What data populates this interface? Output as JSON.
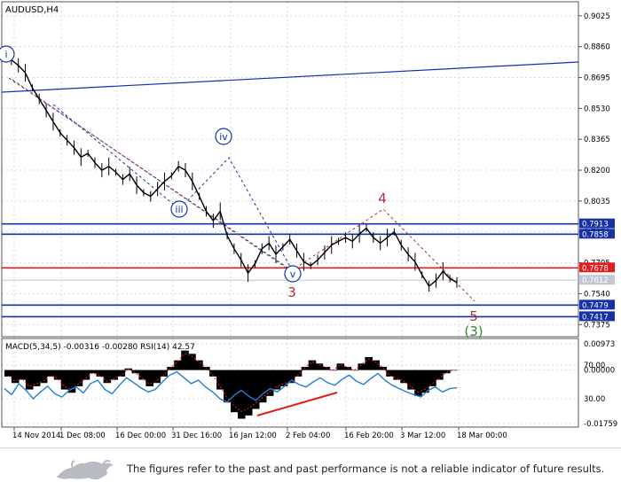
{
  "chart_data": [
    {
      "type": "line",
      "title": "AUDUSD,H4",
      "y_ticks": [
        "0.9025",
        "0.8860",
        "0.8695",
        "0.8530",
        "0.8365",
        "0.8200",
        "0.8035",
        "0.7870",
        "0.7705",
        "0.7540",
        "0.7375"
      ],
      "ylim": [
        0.731,
        0.91
      ],
      "x_ticks": [
        "14 Nov 2014",
        "1 Dec 08:00",
        "16 Dec 00:00",
        "31 Dec 16:00",
        "16 Jan 12:00",
        "2 Feb 04:00",
        "16 Feb 20:00",
        "3 Mar 12:00",
        "18 Mar 00:00"
      ],
      "grid": true,
      "price_series": [
        0.885,
        0.879,
        0.876,
        0.872,
        0.864,
        0.858,
        0.852,
        0.846,
        0.84,
        0.836,
        0.832,
        0.827,
        0.829,
        0.824,
        0.82,
        0.822,
        0.819,
        0.815,
        0.818,
        0.812,
        0.808,
        0.806,
        0.81,
        0.814,
        0.817,
        0.822,
        0.82,
        0.814,
        0.806,
        0.798,
        0.793,
        0.798,
        0.785,
        0.778,
        0.772,
        0.765,
        0.77,
        0.778,
        0.781,
        0.775,
        0.779,
        0.783,
        0.777,
        0.771,
        0.769,
        0.772,
        0.776,
        0.78,
        0.782,
        0.784,
        0.782,
        0.786,
        0.789,
        0.784,
        0.781,
        0.784,
        0.787,
        0.78,
        0.775,
        0.771,
        0.764,
        0.758,
        0.761,
        0.766,
        0.762,
        0.76
      ],
      "horizontal_levels": [
        {
          "value": 0.7913,
          "label": "0.7913",
          "color": "#1630a8"
        },
        {
          "value": 0.7858,
          "label": "0.7858",
          "color": "#1630a8"
        },
        {
          "value": 0.7678,
          "label": "0.7678",
          "color": "#e31d1d"
        },
        {
          "value": 0.7612,
          "label": "0.7612",
          "color": "#c2c8cf"
        },
        {
          "value": 0.7479,
          "label": "0.7479",
          "color": "#1630a8"
        },
        {
          "value": 0.7417,
          "label": "0.7417",
          "color": "#1630a8"
        }
      ],
      "wave_labels": [
        {
          "text": "i",
          "circled": true,
          "color": "#1630a8"
        },
        {
          "text": "iii",
          "circled": true,
          "color": "#1630a8"
        },
        {
          "text": "iv",
          "circled": true,
          "color": "#1630a8"
        },
        {
          "text": "v",
          "circled": true,
          "color": "#1630a8"
        },
        {
          "text": "3",
          "circled": false,
          "color": "#b2322d"
        },
        {
          "text": "4",
          "circled": false,
          "color": "#b2322d"
        },
        {
          "text": "5",
          "circled": false,
          "color": "#b2322d"
        },
        {
          "text": "(3)",
          "circled": false,
          "color": "#2e8b2e"
        }
      ]
    },
    {
      "type": "bar",
      "title": "MACD(5,34,5) -0.00316 -0.00280 RSI(14) 42.57",
      "y_ticks": [
        "0.00973",
        "70.00",
        "0.00000",
        "30.00",
        "-0.01759"
      ],
      "grid": true,
      "macd_values": [
        -0.002,
        -0.004,
        -0.003,
        -0.006,
        -0.005,
        -0.004,
        -0.002,
        -0.003,
        -0.006,
        -0.007,
        -0.005,
        -0.003,
        -0.001,
        -0.002,
        -0.004,
        -0.003,
        -0.002,
        0.0005,
        -0.001,
        -0.003,
        -0.005,
        -0.004,
        -0.002,
        0.001,
        0.003,
        0.006,
        0.005,
        0.003,
        0.001,
        -0.002,
        -0.006,
        -0.01,
        -0.013,
        -0.015,
        -0.014,
        -0.012,
        -0.01,
        -0.008,
        -0.006,
        -0.005,
        -0.004,
        -0.002,
        0.001,
        0.003,
        0.002,
        0.001,
        0.0,
        0.002,
        0.001,
        0.0,
        0.002,
        0.004,
        0.003,
        0.001,
        -0.002,
        -0.003,
        -0.004,
        -0.006,
        -0.008,
        -0.007,
        -0.005,
        -0.003,
        -0.001,
        0.0
      ],
      "rsi_values": [
        42,
        35,
        48,
        40,
        30,
        38,
        45,
        36,
        32,
        40,
        44,
        37,
        48,
        52,
        41,
        36,
        46,
        55,
        49,
        43,
        38,
        41,
        50,
        58,
        62,
        55,
        48,
        52,
        44,
        38,
        30,
        26,
        34,
        40,
        33,
        28,
        36,
        42,
        38,
        45,
        52,
        47,
        44,
        50,
        55,
        49,
        46,
        53,
        58,
        51,
        47,
        54,
        60,
        52,
        46,
        42,
        38,
        35,
        32,
        40,
        44,
        38,
        42,
        43
      ]
    }
  ],
  "disclaimer": {
    "text": "The figures refer to the past and past performance is not a reliable indicator of future results.",
    "logo": "bull-and-bear-logo"
  }
}
